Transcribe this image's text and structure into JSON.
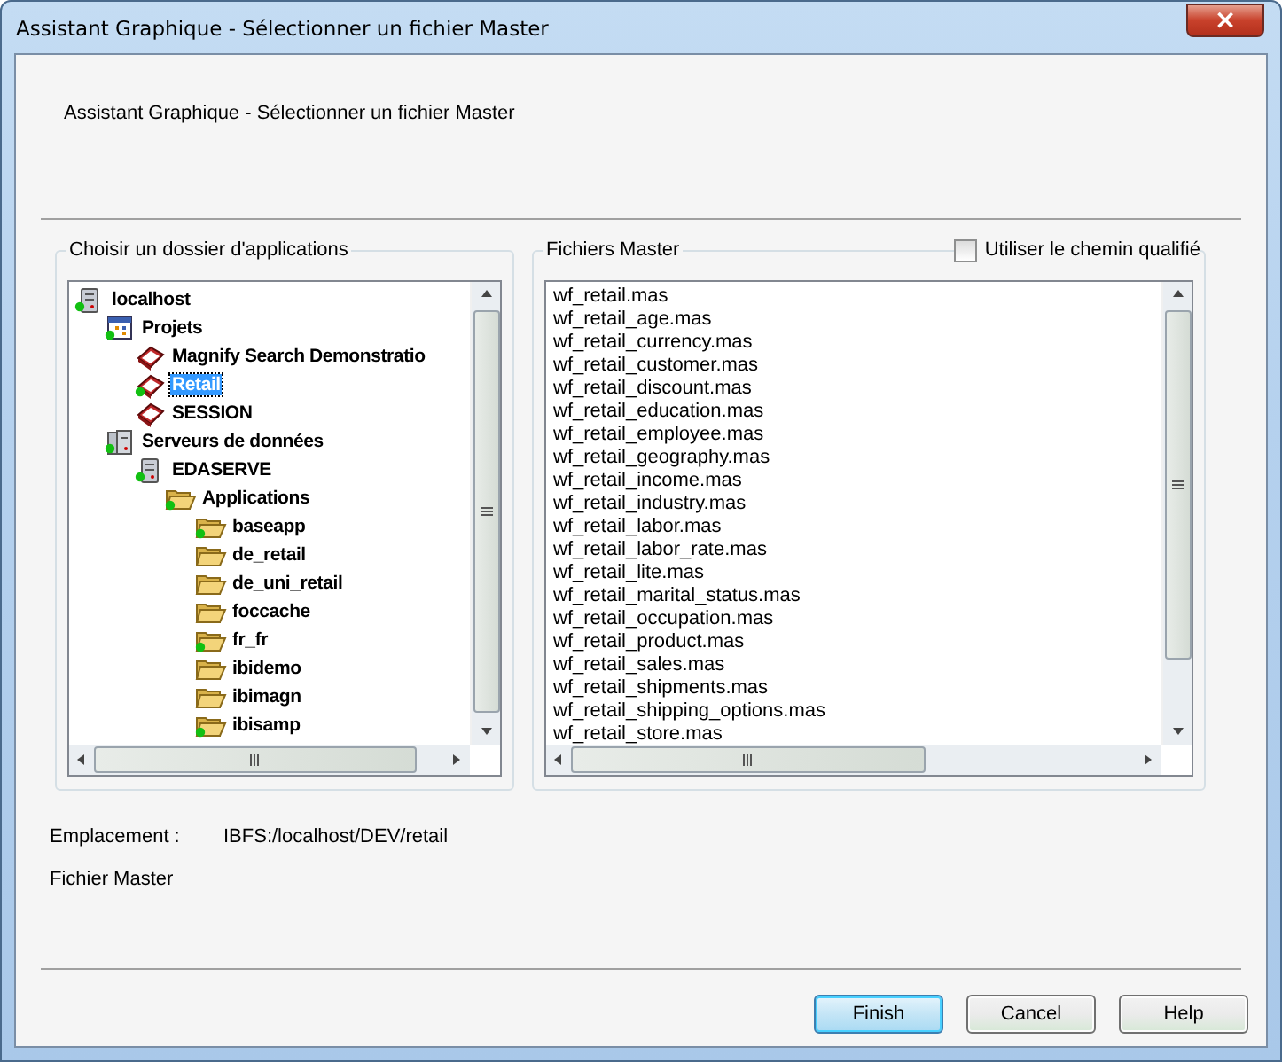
{
  "window": {
    "title": "Assistant Graphique - Sélectionner un fichier Master",
    "close": "×"
  },
  "header": "Assistant Graphique - Sélectionner un fichier Master",
  "folder_group": {
    "label": "Choisir un dossier d'applications",
    "tree": [
      {
        "label": "localhost",
        "kind": "server",
        "linked": true,
        "selected": false,
        "children": [
          {
            "label": "Projets",
            "kind": "projects",
            "linked": true,
            "selected": false,
            "children": [
              {
                "label": "Magnify Search Demonstratio",
                "kind": "project",
                "linked": false,
                "selected": false
              },
              {
                "label": "Retail",
                "kind": "project",
                "linked": true,
                "selected": true
              },
              {
                "label": "SESSION",
                "kind": "project",
                "linked": false,
                "selected": false
              }
            ]
          },
          {
            "label": "Serveurs de données",
            "kind": "servers",
            "linked": true,
            "selected": false,
            "children": [
              {
                "label": "EDASERVE",
                "kind": "server",
                "linked": true,
                "selected": false,
                "children": [
                  {
                    "label": "Applications",
                    "kind": "folder",
                    "linked": true,
                    "selected": false,
                    "children": [
                      {
                        "label": "baseapp",
                        "kind": "folder",
                        "linked": true,
                        "selected": false
                      },
                      {
                        "label": "de_retail",
                        "kind": "folder",
                        "linked": false,
                        "selected": false
                      },
                      {
                        "label": "de_uni_retail",
                        "kind": "folder",
                        "linked": false,
                        "selected": false
                      },
                      {
                        "label": "foccache",
                        "kind": "folder",
                        "linked": false,
                        "selected": false
                      },
                      {
                        "label": "fr_fr",
                        "kind": "folder",
                        "linked": true,
                        "selected": false
                      },
                      {
                        "label": "ibidemo",
                        "kind": "folder",
                        "linked": false,
                        "selected": false
                      },
                      {
                        "label": "ibimagn",
                        "kind": "folder",
                        "linked": false,
                        "selected": false
                      },
                      {
                        "label": "ibisamp",
                        "kind": "folder",
                        "linked": true,
                        "selected": false
                      }
                    ]
                  }
                ]
              }
            ]
          }
        ]
      }
    ]
  },
  "files_group": {
    "label": "Fichiers Master",
    "qualified_path": {
      "label": "Utiliser le chemin qualifié",
      "checked": false
    },
    "files": [
      {
        "label": "wf_retail.mas",
        "selected": false
      },
      {
        "label": "wf_retail_age.mas",
        "selected": false
      },
      {
        "label": "wf_retail_currency.mas",
        "selected": false
      },
      {
        "label": "wf_retail_customer.mas",
        "selected": false
      },
      {
        "label": "wf_retail_discount.mas",
        "selected": false
      },
      {
        "label": "wf_retail_education.mas",
        "selected": false
      },
      {
        "label": "wf_retail_employee.mas",
        "selected": false
      },
      {
        "label": "wf_retail_geography.mas",
        "selected": false
      },
      {
        "label": "wf_retail_income.mas",
        "selected": false
      },
      {
        "label": "wf_retail_industry.mas",
        "selected": false
      },
      {
        "label": "wf_retail_labor.mas",
        "selected": false
      },
      {
        "label": "wf_retail_labor_rate.mas",
        "selected": false
      },
      {
        "label": "wf_retail_lite.mas",
        "selected": false
      },
      {
        "label": "wf_retail_marital_status.mas",
        "selected": false
      },
      {
        "label": "wf_retail_occupation.mas",
        "selected": false
      },
      {
        "label": "wf_retail_product.mas",
        "selected": false
      },
      {
        "label": "wf_retail_sales.mas",
        "selected": false
      },
      {
        "label": "wf_retail_shipments.mas",
        "selected": false
      },
      {
        "label": "wf_retail_shipping_options.mas",
        "selected": false
      },
      {
        "label": "wf_retail_store.mas",
        "selected": false
      }
    ]
  },
  "location": {
    "label": "Emplacement :",
    "value": "IBFS:/localhost/DEV/retail"
  },
  "master_label": "Fichier Master",
  "buttons": [
    {
      "label": "Finish",
      "default": true
    },
    {
      "label": "Cancel",
      "default": false
    },
    {
      "label": "Help",
      "default": false
    }
  ]
}
